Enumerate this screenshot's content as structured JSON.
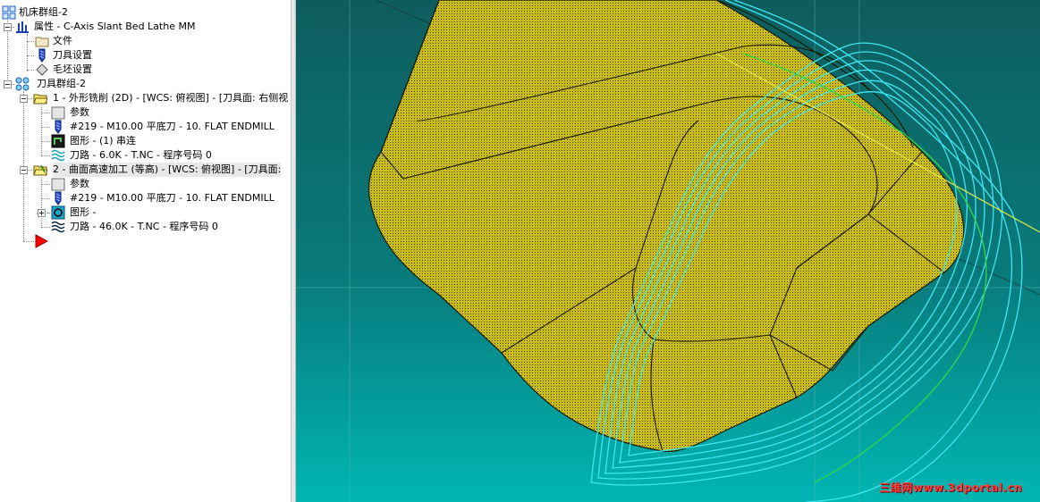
{
  "tree": {
    "machine_group": "机床群组-2",
    "properties": "属性 - C-Axis Slant Bed Lathe MM",
    "files": "文件",
    "tool_settings": "刀具设置",
    "stock_settings": "毛坯设置",
    "toolpath_group": "刀具群组-2",
    "op1": {
      "title": "1 - 外形铣削 (2D) - [WCS: 俯视图] - [刀具面: 右侧视",
      "params": "参数",
      "tool": "#219 - M10.00 平底刀 -    10. FLAT ENDMILL",
      "geometry": "图形 - (1) 串连",
      "toolpath": "刀路 - 6.0K - T.NC - 程序号码 0"
    },
    "op2": {
      "title": "2 - 曲面高速加工 (等高) - [WCS: 俯视图] - [刀具面:",
      "params": "参数",
      "tool": "#219 - M10.00 平底刀 -    10. FLAT ENDMILL",
      "geometry": "图形 -",
      "toolpath": "刀路 - 46.0K - T.NC - 程序号码 0"
    }
  },
  "watermark": "三维网www.3dportal.cn",
  "colors": {
    "part_yellow": "#d6c81c",
    "viewport_gradient_top": "#0e5d5e",
    "viewport_gradient_bottom": "#00b6b3",
    "toolpath_cyan": "#3fe6f0",
    "insert_arrow": "#ff0000"
  }
}
